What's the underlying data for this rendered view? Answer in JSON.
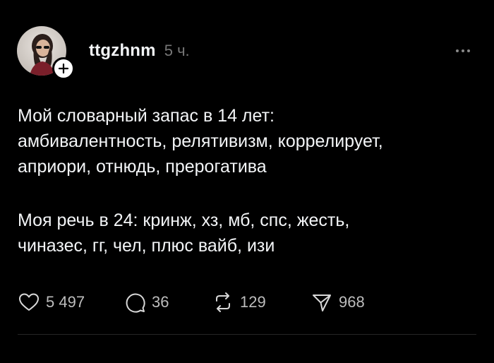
{
  "post": {
    "username": "ttgzhnm",
    "time": "5 ч.",
    "paragraph1": {
      "lines": [
        "Мой словарный запас в 14 лет:",
        "амбивалентность, релятивизм, коррелирует,",
        "априори, отнюдь, прерогатива"
      ]
    },
    "paragraph2": {
      "lines": [
        "Моя речь в 24: кринж, хз, мб, спс, жесть,",
        "чиназес, гг, чел, плюс вайб, изи"
      ]
    },
    "actions": {
      "likes": "5 497",
      "comments": "36",
      "reposts": "129",
      "shares": "968"
    }
  },
  "icons": {
    "like": "heart-icon",
    "comment": "comment-bubble-icon",
    "repost": "repost-icon",
    "share": "send-icon",
    "more": "more-dots-icon",
    "follow": "plus-icon"
  },
  "colors": {
    "background": "#000000",
    "text": "#f3f5f7",
    "muted": "#777777",
    "counts": "#bdbdbd"
  }
}
